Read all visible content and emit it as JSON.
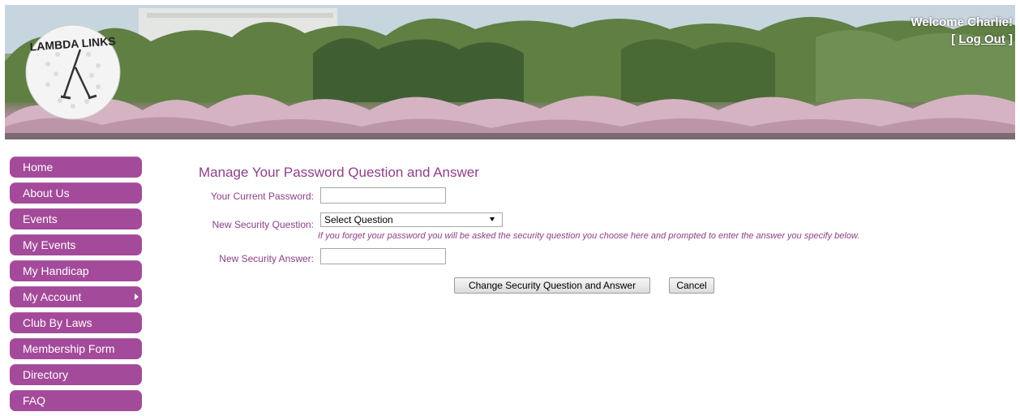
{
  "header": {
    "logo_text": "LAMBDA LINKS",
    "welcome": "Welcome Charlie!",
    "logout_open": "[ ",
    "logout_label": "Log Out",
    "logout_close": " ]"
  },
  "sidebar": {
    "items": [
      {
        "label": "Home"
      },
      {
        "label": "About Us"
      },
      {
        "label": "Events"
      },
      {
        "label": "My Events"
      },
      {
        "label": "My Handicap"
      },
      {
        "label": "My Account"
      },
      {
        "label": "Club By Laws"
      },
      {
        "label": "Membership Form"
      },
      {
        "label": "Directory"
      },
      {
        "label": "FAQ"
      }
    ]
  },
  "form": {
    "title": "Manage Your Password Question and Answer",
    "current_password_label": "Your Current Password:",
    "current_password_value": "",
    "question_label": "New Security Question:",
    "question_selected": "Select Question",
    "hint": "If you forget your password you will be asked the security question you choose here and prompted to enter the answer you specify below.",
    "answer_label": "New Security Answer:",
    "answer_value": "",
    "submit_label": "Change Security Question and Answer",
    "cancel_label": "Cancel"
  },
  "colors": {
    "accent": "#a44a9a",
    "label_text": "#8e3f88"
  }
}
